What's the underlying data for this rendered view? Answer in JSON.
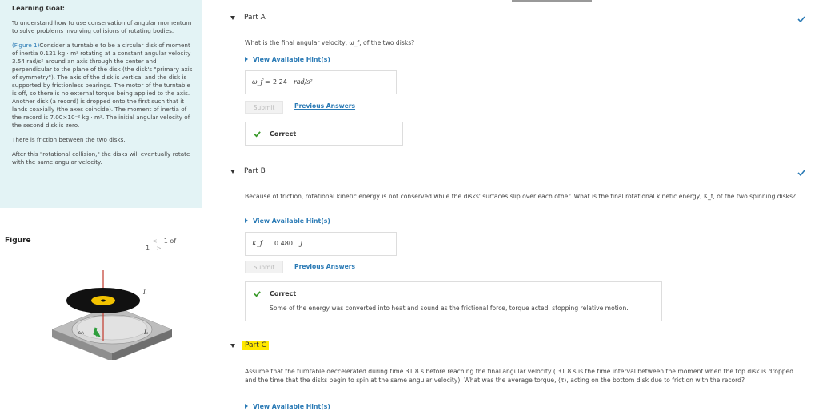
{
  "learning_goal": {
    "title": "Learning Goal:",
    "intro": "To understand how to use conservation of angular momentum to solve problems involving collisions of rotating bodies.",
    "figure_link": "(Figure 1)",
    "p1_a": "Consider a turntable to be a circular disk of moment of inertia 0.121 kg · m² rotating at a constant angular velocity 3.54 rad/s² around an axis through the center and perpendicular to the plane of the disk (the disk's \"primary axis of symmetry\"). The axis of the disk is vertical and the disk is supported by frictionless bearings. The motor of the turntable is off, so there is no external torque being applied to the axis.",
    "p1_b": "Another disk (a record) is dropped onto the first such that it lands coaxially (the axes coincide). The moment of inertia of the record is 7.00×10⁻² kg · m². The initial angular velocity of the second disk is zero.",
    "p2": "There is friction between the two disks.",
    "p3": "After this \"rotational collision,\" the disks will eventually rotate with the same angular velocity."
  },
  "figure": {
    "title": "Figure",
    "pager": "1 of 1",
    "prev_arrow": "<",
    "next_arrow": ">",
    "label_omega": "ωᵢ",
    "label_i1": "I₁",
    "label_it": "Iₜ"
  },
  "parts": {
    "a": {
      "label": "Part A",
      "question": "What is the final angular velocity, ω_f, of the two disks?",
      "hint": "View Available Hint(s)",
      "answer_symbol": "ω_f =",
      "answer_value": "2.24",
      "answer_unit": "rad/s²",
      "submit": "Submit",
      "previous": "Previous Answers",
      "status": "Correct"
    },
    "b": {
      "label": "Part B",
      "question": "Because of friction, rotational kinetic energy is not conserved while the disks' surfaces slip over each other. What is the final rotational kinetic energy, K_f, of the two spinning disks?",
      "hint": "View Available Hint(s)",
      "answer_symbol": "K_f",
      "answer_value": "0.480",
      "answer_unit": "J",
      "submit": "Submit",
      "previous": "Previous Answers",
      "status": "Correct",
      "comment": "Some of the energy was converted into heat and sound as the frictional force, torque acted, stopping relative motion."
    },
    "c": {
      "label": "Part C",
      "question": "Assume that the turntable deccelerated during time 31.8 s before reaching the final angular velocity ( 31.8 s is the time interval between the moment when the top disk is dropped and the time that the disks begin to spin at the same angular velocity). What was the average torque, ⟨τ⟩, acting on the bottom disk due to friction with the record?",
      "hint": "View Available Hint(s)"
    }
  },
  "colors": {
    "accent": "#2a7ab5",
    "goal_bg": "#e3f3f5",
    "highlight": "#ffe800",
    "correct": "#3a9a2a"
  }
}
